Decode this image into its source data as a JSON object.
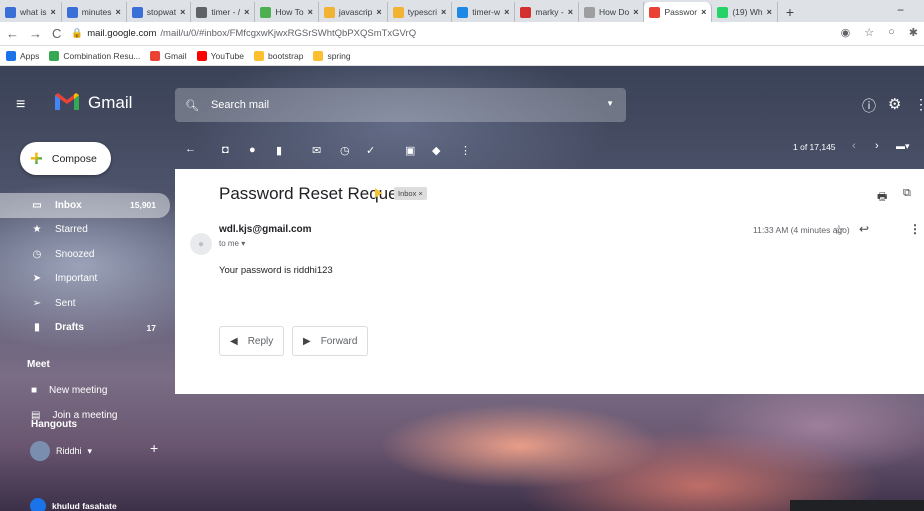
{
  "browser": {
    "tabs": [
      {
        "title": "what is",
        "color": "#3b6fd8"
      },
      {
        "title": "minutes",
        "color": "#3b6fd8"
      },
      {
        "title": "stopwat",
        "color": "#3b6fd8"
      },
      {
        "title": "timer - /",
        "color": "#5f6368"
      },
      {
        "title": "How To",
        "color": "#4caf50"
      },
      {
        "title": "javascrip",
        "color": "#f2b233"
      },
      {
        "title": "typescri",
        "color": "#f2b233"
      },
      {
        "title": "timer-w",
        "color": "#1e88e5"
      },
      {
        "title": "marky -",
        "color": "#d32f2f"
      },
      {
        "title": "How Do",
        "color": "#9e9e9e"
      },
      {
        "title": "Passwor",
        "color": "#ea4335"
      },
      {
        "title": "(19) Wh",
        "color": "#25d366"
      }
    ],
    "active_tab_index": 10,
    "new_tab": "+",
    "minimize": "−",
    "url_host": "mail.google.com",
    "url_path": "/mail/u/0/#inbox/FMfcgxwKjwxRGSrSWhtQbPXQSmTxGVrQ",
    "bookmarks": [
      {
        "label": "Apps",
        "color": "#1a73e8"
      },
      {
        "label": "Combination Resu...",
        "color": "#34a853"
      },
      {
        "label": "Gmail",
        "color": "#ea4335"
      },
      {
        "label": "YouTube",
        "color": "#ff0000"
      },
      {
        "label": "bootstrap",
        "color": "#fbc02d"
      },
      {
        "label": "spring",
        "color": "#fbc02d"
      }
    ]
  },
  "gmail": {
    "app_name": "Gmail",
    "search_placeholder": "Search mail",
    "compose_label": "Compose",
    "nav": [
      {
        "label": "Inbox",
        "count": "15,901",
        "icon": "▭",
        "active": true,
        "bold": true
      },
      {
        "label": "Starred",
        "count": "",
        "icon": "★",
        "active": false,
        "bold": false
      },
      {
        "label": "Snoozed",
        "count": "",
        "icon": "◷",
        "active": false,
        "bold": false
      },
      {
        "label": "Important",
        "count": "",
        "icon": "➤",
        "active": false,
        "bold": false
      },
      {
        "label": "Sent",
        "count": "",
        "icon": "➢",
        "active": false,
        "bold": false
      },
      {
        "label": "Drafts",
        "count": "17",
        "icon": "▮",
        "active": false,
        "bold": true
      }
    ],
    "meet": {
      "heading": "Meet",
      "new_meeting": "New meeting",
      "join_meeting": "Join a meeting"
    },
    "hangouts": {
      "heading": "Hangouts",
      "user": "Riddhi",
      "contact": "khulud fasahate"
    },
    "pagination": "1 of 17,145"
  },
  "email": {
    "subject": "Password Reset Request",
    "label_chip": "Inbox ×",
    "sender": "wdl.kjs@gmail.com",
    "to": "to me ▾",
    "timestamp": "11:33 AM (4 minutes ago)",
    "body": "Your password is riddhi123",
    "reply_label": "Reply",
    "forward_label": "Forward"
  }
}
